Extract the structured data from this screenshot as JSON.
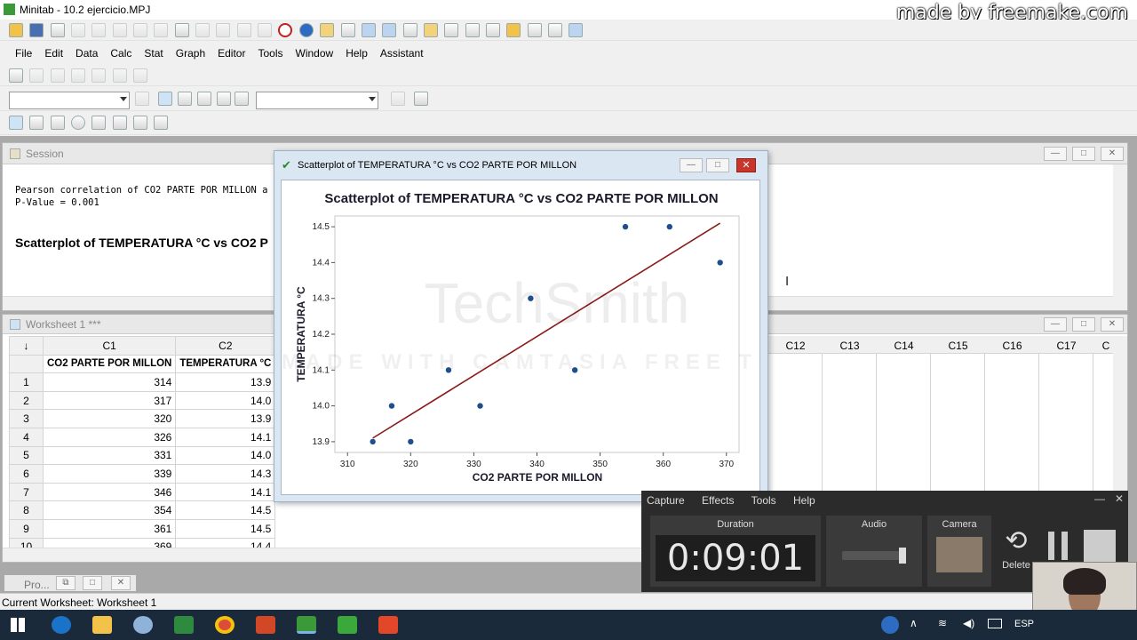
{
  "window": {
    "title": "Minitab - 10.2 ejercicio.MPJ"
  },
  "watermark": {
    "top_right": "made by freemake.com",
    "center_brand": "TechSmith",
    "center_trial": "MADE WITH CAMTASIA FREE TRIAL"
  },
  "menu": [
    "File",
    "Edit",
    "Data",
    "Calc",
    "Stat",
    "Graph",
    "Editor",
    "Tools",
    "Window",
    "Help",
    "Assistant"
  ],
  "session": {
    "title": "Session",
    "line1": "Pearson correlation of CO2 PARTE POR MILLON a",
    "line2": "P-Value = 0.001",
    "heading": "Scatterplot of TEMPERATURA °C vs CO2 P"
  },
  "worksheet": {
    "title": "Worksheet 1 ***",
    "corner": "↓",
    "col_ids": [
      "C1",
      "C2"
    ],
    "col_names": [
      "CO2 PARTE POR MILLON",
      "TEMPERATURA °C"
    ],
    "right_cols": [
      "C12",
      "C13",
      "C14",
      "C15",
      "C16",
      "C17",
      "C"
    ],
    "rows": [
      {
        "n": "1",
        "c1": "314",
        "c2": "13.9"
      },
      {
        "n": "2",
        "c1": "317",
        "c2": "14.0"
      },
      {
        "n": "3",
        "c1": "320",
        "c2": "13.9"
      },
      {
        "n": "4",
        "c1": "326",
        "c2": "14.1"
      },
      {
        "n": "5",
        "c1": "331",
        "c2": "14.0"
      },
      {
        "n": "6",
        "c1": "339",
        "c2": "14.3"
      },
      {
        "n": "7",
        "c1": "346",
        "c2": "14.1"
      },
      {
        "n": "8",
        "c1": "354",
        "c2": "14.5"
      },
      {
        "n": "9",
        "c1": "361",
        "c2": "14.5"
      },
      {
        "n": "10",
        "c1": "369",
        "c2": "14.4"
      }
    ]
  },
  "project_tab": "Pro...",
  "status_bar": "Current Worksheet: Worksheet 1",
  "graph_window": {
    "title": "Scatterplot of TEMPERATURA °C vs CO2 PARTE POR MILLON"
  },
  "chart_data": {
    "type": "scatter",
    "title": "Scatterplot of TEMPERATURA °C vs CO2 PARTE POR MILLON",
    "xlabel": "CO2 PARTE POR MILLON",
    "ylabel": "TEMPERATURA °C",
    "x": [
      314,
      317,
      320,
      326,
      331,
      339,
      346,
      354,
      361,
      369
    ],
    "y": [
      13.9,
      14.0,
      13.9,
      14.1,
      14.0,
      14.3,
      14.1,
      14.5,
      14.5,
      14.4
    ],
    "xlim": [
      308,
      372
    ],
    "ylim": [
      13.87,
      14.53
    ],
    "xticks": [
      310,
      320,
      330,
      340,
      350,
      360,
      370
    ],
    "yticks": [
      13.9,
      14.0,
      14.1,
      14.2,
      14.3,
      14.4,
      14.5
    ],
    "fit_line": {
      "x": [
        314,
        369
      ],
      "y": [
        13.91,
        14.51
      ]
    },
    "colors": {
      "points": "#1f4e8c",
      "fit": "#8b1a1a"
    }
  },
  "recorder": {
    "menu": [
      "Capture",
      "Effects",
      "Tools",
      "Help"
    ],
    "duration_label": "Duration",
    "duration": "0:09:01",
    "audio_label": "Audio",
    "camera_label": "Camera",
    "delete_label": "Delete"
  },
  "tray": {
    "lang": "ESP"
  }
}
